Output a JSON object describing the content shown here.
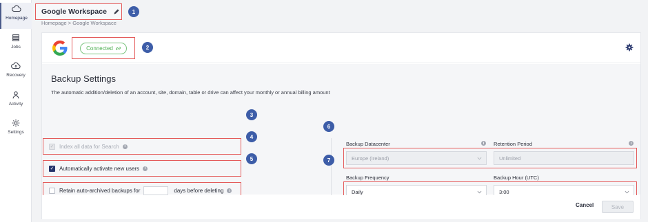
{
  "sidebar": {
    "items": [
      {
        "label": "Homepage",
        "icon": "cloud-icon"
      },
      {
        "label": "Jobs",
        "icon": "server-icon"
      },
      {
        "label": "Recovery",
        "icon": "cloud-upload-icon"
      },
      {
        "label": "Activity",
        "icon": "person-icon"
      },
      {
        "label": "Settings",
        "icon": "gear-icon"
      }
    ]
  },
  "header": {
    "title": "Google Workspace",
    "breadcrumb": "Homepage > Google Workspace"
  },
  "callouts": [
    "1",
    "2",
    "3",
    "4",
    "5",
    "6",
    "7"
  ],
  "connection": {
    "status": "Connected"
  },
  "backup_settings": {
    "title": "Backup Settings",
    "description": "The automatic addition/deletion of an account, site, domain, table or drive can affect your monthly or annual billing amount",
    "index_label": "Index all data for Search",
    "auto_activate_label": "Automatically activate new users",
    "retain_prefix": "Retain auto-archived backups for",
    "retain_suffix": "days before deleting",
    "datacenter_label": "Backup Datacenter",
    "datacenter_value": "Europe (Ireland)",
    "retention_label": "Retention Period",
    "retention_value": "Unlimited",
    "frequency_label": "Backup Frequency",
    "frequency_value": "Daily",
    "hour_label": "Backup Hour (UTC)",
    "hour_value": "3:00"
  },
  "footer": {
    "cancel": "Cancel",
    "save": "Save"
  },
  "colors": {
    "accent": "#3d5da8",
    "highlight": "#e45b5b",
    "connected": "#4caf50"
  }
}
